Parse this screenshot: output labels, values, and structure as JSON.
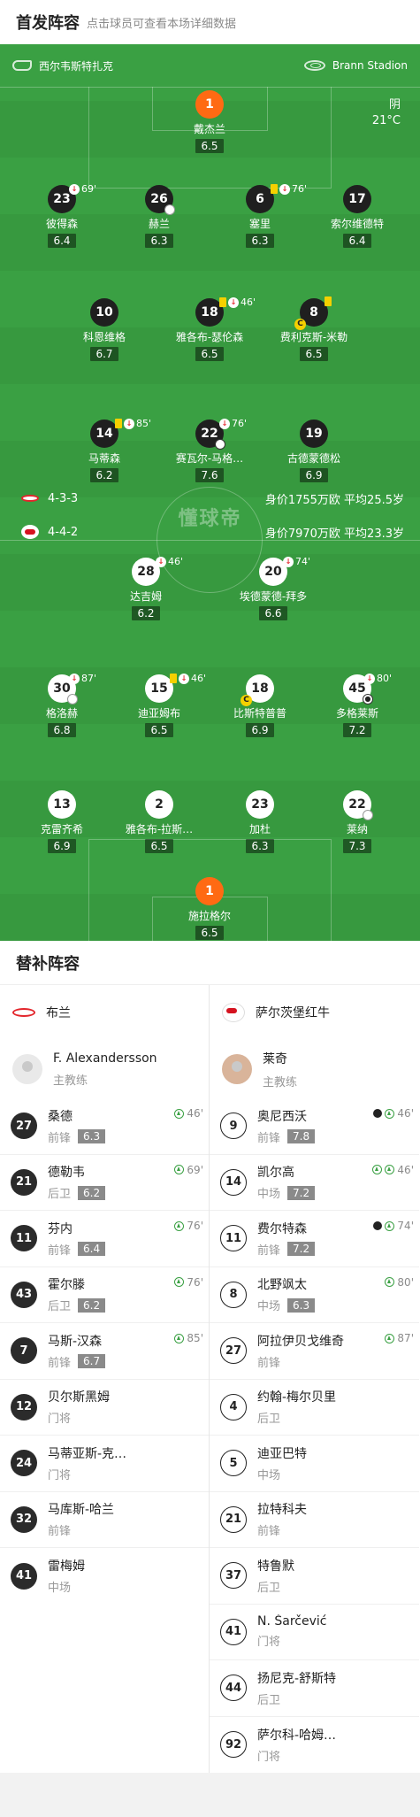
{
  "header": {
    "title": "首发阵容",
    "subtitle": "点击球员可查看本场详细数据"
  },
  "match": {
    "home_team": "西尔韦斯特扎克",
    "venue": "Brann Stadion",
    "weather": "阴",
    "temperature": "21°C",
    "watermark": "懂球帝",
    "home_formation": "4-3-3",
    "home_value": "身价1755万欧 平均25.5岁",
    "away_formation": "4-4-2",
    "away_value": "身价7970万欧 平均23.3岁"
  },
  "home_lineup": [
    {
      "num": "1",
      "name": "戴杰兰",
      "rating": "6.5"
    },
    {
      "num": "23",
      "name": "彼得森",
      "rating": "6.4",
      "event": "69'"
    },
    {
      "num": "26",
      "name": "赫兰",
      "rating": "6.3"
    },
    {
      "num": "6",
      "name": "塞里",
      "rating": "6.3",
      "event": "76'"
    },
    {
      "num": "17",
      "name": "索尔维德特",
      "rating": "6.4"
    },
    {
      "num": "10",
      "name": "科恩维格",
      "rating": "6.7"
    },
    {
      "num": "18",
      "name": "雅各布-瑟伦森",
      "rating": "6.5",
      "event": "46'"
    },
    {
      "num": "8",
      "name": "费利克斯-米勒",
      "rating": "6.5"
    },
    {
      "num": "14",
      "name": "马蒂森",
      "rating": "6.2",
      "event": "85'"
    },
    {
      "num": "22",
      "name": "赛瓦尔-马格…",
      "rating": "7.6",
      "event": "76'"
    },
    {
      "num": "19",
      "name": "古德蒙德松",
      "rating": "6.9"
    }
  ],
  "away_lineup": [
    {
      "num": "28",
      "name": "达吉姆",
      "rating": "6.2",
      "event": "46'"
    },
    {
      "num": "20",
      "name": "埃德蒙德-拜多",
      "rating": "6.6",
      "event": "74'"
    },
    {
      "num": "30",
      "name": "格洛赫",
      "rating": "6.8",
      "event": "87'"
    },
    {
      "num": "15",
      "name": "迪亚姆布",
      "rating": "6.5",
      "event": "46'"
    },
    {
      "num": "18",
      "name": "比斯特普普",
      "rating": "6.9"
    },
    {
      "num": "45",
      "name": "多格莱斯",
      "rating": "7.2",
      "event": "80'"
    },
    {
      "num": "13",
      "name": "克雷齐希",
      "rating": "6.9"
    },
    {
      "num": "2",
      "name": "雅各布-拉斯…",
      "rating": "6.5"
    },
    {
      "num": "23",
      "name": "加杜",
      "rating": "6.3"
    },
    {
      "num": "22",
      "name": "莱纳",
      "rating": "7.3"
    },
    {
      "num": "1",
      "name": "施拉格尔",
      "rating": "6.5"
    }
  ],
  "subs": {
    "title": "替补阵容",
    "home": {
      "team": "布兰",
      "coach": "F. Alexandersson",
      "coach_role": "主教练",
      "players": [
        {
          "num": "27",
          "name": "桑德",
          "pos": "前锋",
          "rating": "6.3",
          "in": "46'"
        },
        {
          "num": "21",
          "name": "德勒韦",
          "pos": "后卫",
          "rating": "6.2",
          "in": "69'"
        },
        {
          "num": "11",
          "name": "芬内",
          "pos": "前锋",
          "rating": "6.4",
          "in": "76'"
        },
        {
          "num": "43",
          "name": "霍尔滕",
          "pos": "后卫",
          "rating": "6.2",
          "in": "76'"
        },
        {
          "num": "7",
          "name": "马斯-汉森",
          "pos": "前锋",
          "rating": "6.7",
          "in": "85'"
        },
        {
          "num": "12",
          "name": "贝尔斯黑姆",
          "pos": "门将"
        },
        {
          "num": "24",
          "name": "马蒂亚斯-克…",
          "pos": "门将"
        },
        {
          "num": "32",
          "name": "马库斯-哈兰",
          "pos": "前锋"
        },
        {
          "num": "41",
          "name": "雷梅姆",
          "pos": "中场"
        }
      ]
    },
    "away": {
      "team": "萨尔茨堡红牛",
      "coach": "莱奇",
      "coach_role": "主教练",
      "players": [
        {
          "num": "9",
          "name": "奥尼西沃",
          "pos": "前锋",
          "rating": "7.8",
          "in": "46'"
        },
        {
          "num": "14",
          "name": "凯尔高",
          "pos": "中场",
          "rating": "7.2",
          "in": "46'"
        },
        {
          "num": "11",
          "name": "费尔特森",
          "pos": "前锋",
          "rating": "7.2",
          "in": "74'"
        },
        {
          "num": "8",
          "name": "北野飒太",
          "pos": "中场",
          "rating": "6.3",
          "in": "80'"
        },
        {
          "num": "27",
          "name": "阿拉伊贝戈维奇",
          "pos": "前锋",
          "in": "87'"
        },
        {
          "num": "4",
          "name": "约翰-梅尔贝里",
          "pos": "后卫"
        },
        {
          "num": "5",
          "name": "迪亚巴特",
          "pos": "中场"
        },
        {
          "num": "21",
          "name": "拉特科夫",
          "pos": "前锋"
        },
        {
          "num": "37",
          "name": "特鲁默",
          "pos": "后卫"
        },
        {
          "num": "41",
          "name": "N. Šarčević",
          "pos": "门将"
        },
        {
          "num": "44",
          "name": "扬尼克-舒斯特",
          "pos": "后卫"
        },
        {
          "num": "92",
          "name": "萨尔科-哈姆…",
          "pos": "门将"
        }
      ]
    }
  }
}
